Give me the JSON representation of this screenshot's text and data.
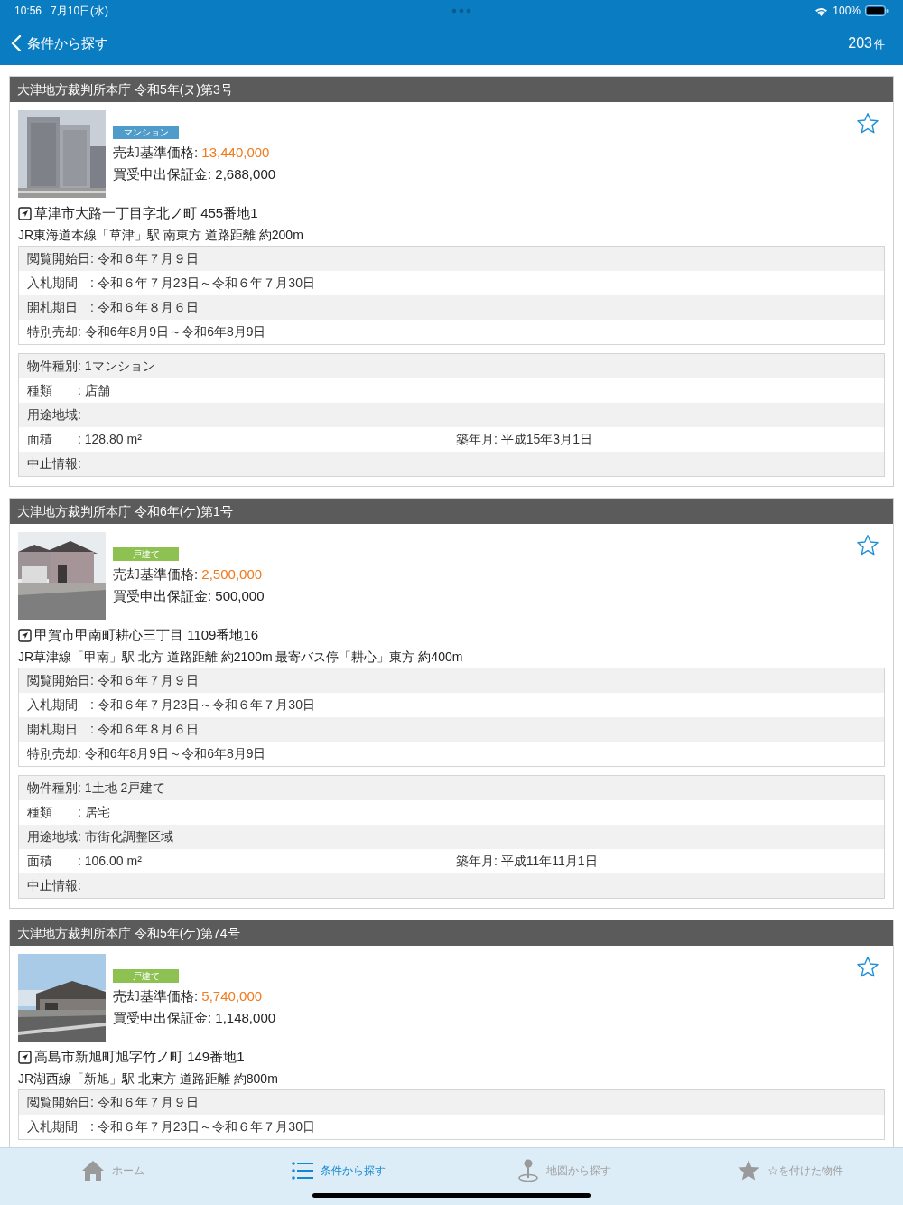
{
  "status_bar": {
    "time": "10:56",
    "date": "7月10日(水)",
    "battery": "100%"
  },
  "nav": {
    "back_label": "条件から探す",
    "count": "203",
    "count_unit": "件"
  },
  "cards": [
    {
      "header": "大津地方裁判所本庁 令和5年(ヌ)第3号",
      "tag": {
        "label": "マンション",
        "kind": "mansion"
      },
      "favorite": false,
      "price_label": "売却基準価格:",
      "price": "13,440,000",
      "deposit_label": "買受申出保証金:",
      "deposit": "2,688,000",
      "address": "草津市大路一丁目字北ノ町 455番地1",
      "access": "JR東海道本線「草津」駅 南東方 道路距離 約200m",
      "schedule": [
        "閲覧開始日: 令和６年７月９日",
        "入札期間　: 令和６年７月23日～令和６年７月30日",
        "開札期日　: 令和６年８月６日",
        "特別売却: 令和6年8月9日～令和6年8月9日"
      ],
      "details": [
        {
          "cells": [
            "物件種別: 1マンション"
          ]
        },
        {
          "cells": [
            "種類　　: 店舗"
          ]
        },
        {
          "cells": [
            "用途地域:"
          ]
        },
        {
          "cells": [
            "面積　　: 128.80 m²",
            "築年月: 平成15年3月1日"
          ]
        },
        {
          "cells": [
            "中止情報:"
          ]
        }
      ]
    },
    {
      "header": "大津地方裁判所本庁 令和6年(ケ)第1号",
      "tag": {
        "label": "戸建て",
        "kind": "house"
      },
      "favorite": false,
      "price_label": "売却基準価格:",
      "price": "2,500,000",
      "deposit_label": "買受申出保証金:",
      "deposit": "500,000",
      "address": "甲賀市甲南町耕心三丁目 1109番地16",
      "access": "JR草津線「甲南」駅 北方 道路距離 約2100m 最寄バス停「耕心」東方 約400m",
      "schedule": [
        "閲覧開始日: 令和６年７月９日",
        "入札期間　: 令和６年７月23日～令和６年７月30日",
        "開札期日　: 令和６年８月６日",
        "特別売却: 令和6年8月9日～令和6年8月9日"
      ],
      "details": [
        {
          "cells": [
            "物件種別: 1土地 2戸建て"
          ]
        },
        {
          "cells": [
            "種類　　: 居宅"
          ]
        },
        {
          "cells": [
            "用途地域: 市街化調整区域"
          ]
        },
        {
          "cells": [
            "面積　　: 106.00 m²",
            "築年月: 平成11年11月1日"
          ]
        },
        {
          "cells": [
            "中止情報:"
          ]
        }
      ]
    },
    {
      "header": "大津地方裁判所本庁 令和5年(ケ)第74号",
      "tag": {
        "label": "戸建て",
        "kind": "house"
      },
      "favorite": false,
      "price_label": "売却基準価格:",
      "price": "5,740,000",
      "deposit_label": "買受申出保証金:",
      "deposit": "1,148,000",
      "address": "高島市新旭町旭字竹ノ町 149番地1",
      "access": "JR湖西線「新旭」駅 北東方 道路距離 約800m",
      "schedule": [
        "閲覧開始日: 令和６年７月９日",
        "入札期間　: 令和６年７月23日～令和６年７月30日"
      ]
    }
  ],
  "tab_bar": [
    {
      "label": "ホーム",
      "selected": false
    },
    {
      "label": "条件から探す",
      "selected": true
    },
    {
      "label": "地図から探す",
      "selected": false
    },
    {
      "label": "☆を付けた物件",
      "selected": false
    }
  ]
}
